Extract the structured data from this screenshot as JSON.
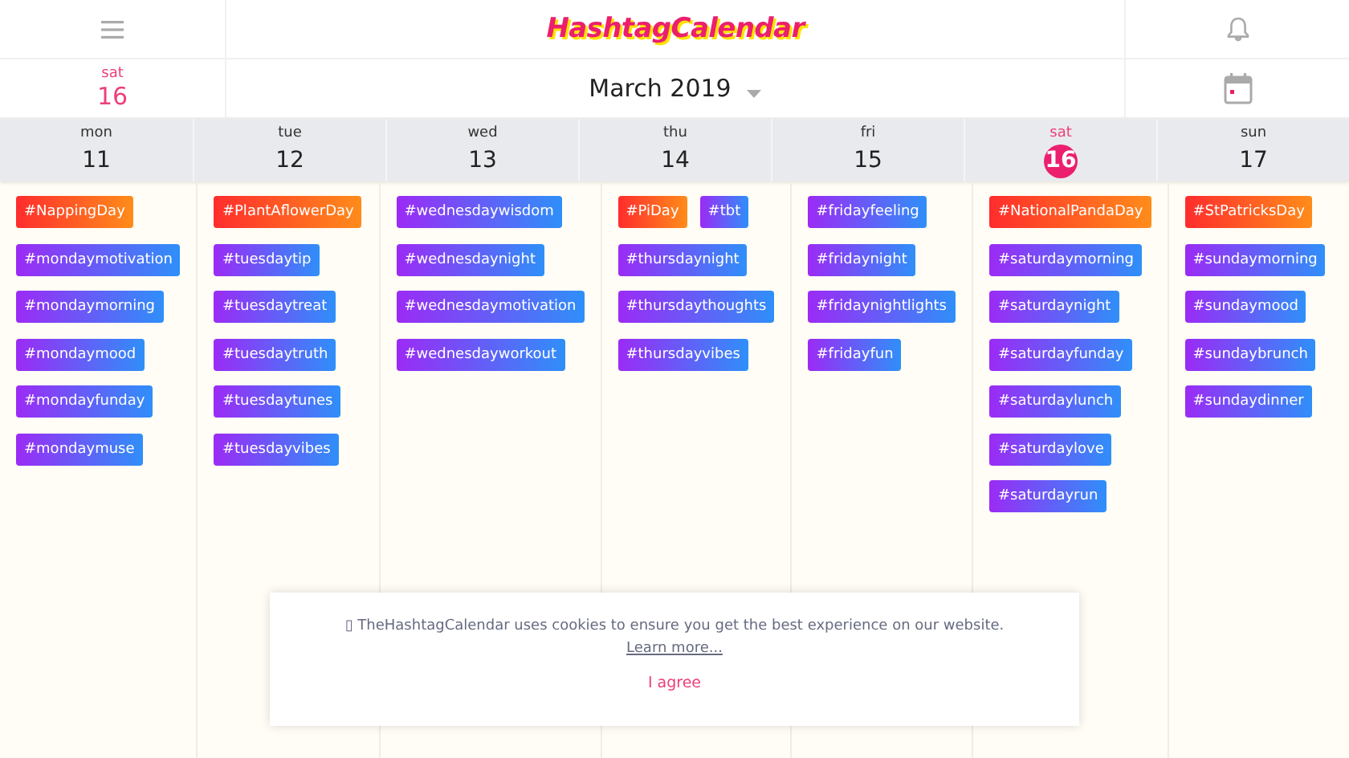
{
  "header": {
    "logo": "HashtagCalendar"
  },
  "today": {
    "weekday": "sat",
    "day": "16"
  },
  "month_picker": {
    "label": "March 2019"
  },
  "days": [
    {
      "weekday": "mon",
      "day": "11",
      "selected": false,
      "tags": [
        {
          "label": "#NappingDay",
          "kind": "holiday"
        },
        {
          "label": "#mondaymotivation",
          "kind": "daily"
        },
        {
          "label": "#mondaymorning",
          "kind": "daily"
        },
        {
          "label": "#mondaymood",
          "kind": "daily"
        },
        {
          "label": "#mondayfunday",
          "kind": "daily"
        },
        {
          "label": "#mondaymuse",
          "kind": "daily"
        }
      ]
    },
    {
      "weekday": "tue",
      "day": "12",
      "selected": false,
      "tags": [
        {
          "label": "#PlantAflowerDay",
          "kind": "holiday"
        },
        {
          "label": "#tuesdaytip",
          "kind": "daily"
        },
        {
          "label": "#tuesdaytreat",
          "kind": "daily"
        },
        {
          "label": "#tuesdaytruth",
          "kind": "daily"
        },
        {
          "label": "#tuesdaytunes",
          "kind": "daily"
        },
        {
          "label": "#tuesdayvibes",
          "kind": "daily"
        }
      ]
    },
    {
      "weekday": "wed",
      "day": "13",
      "selected": false,
      "tags": [
        {
          "label": "#wednesdaywisdom",
          "kind": "daily"
        },
        {
          "label": "#wednesdaynight",
          "kind": "daily"
        },
        {
          "label": "#wednesdaymotivation",
          "kind": "daily"
        },
        {
          "label": "#wednesdayworkout",
          "kind": "daily"
        }
      ]
    },
    {
      "weekday": "thu",
      "day": "14",
      "selected": false,
      "tags": [
        {
          "label": "#PiDay",
          "kind": "holiday"
        },
        {
          "label": "#tbt",
          "kind": "daily"
        },
        {
          "label": "#thursdaynight",
          "kind": "daily"
        },
        {
          "label": "#thursdaythoughts",
          "kind": "daily"
        },
        {
          "label": "#thursdayvibes",
          "kind": "daily"
        }
      ]
    },
    {
      "weekday": "fri",
      "day": "15",
      "selected": false,
      "tags": [
        {
          "label": "#fridayfeeling",
          "kind": "daily"
        },
        {
          "label": "#fridaynight",
          "kind": "daily"
        },
        {
          "label": "#fridaynightlights",
          "kind": "daily"
        },
        {
          "label": "#fridayfun",
          "kind": "daily"
        }
      ]
    },
    {
      "weekday": "sat",
      "day": "16",
      "selected": true,
      "tags": [
        {
          "label": "#NationalPandaDay",
          "kind": "holiday"
        },
        {
          "label": "#saturdaymorning",
          "kind": "daily"
        },
        {
          "label": "#saturdaynight",
          "kind": "daily"
        },
        {
          "label": "#saturdayfunday",
          "kind": "daily"
        },
        {
          "label": "#saturdaylunch",
          "kind": "daily"
        },
        {
          "label": "#saturdaylove",
          "kind": "daily"
        },
        {
          "label": "#saturdayrun",
          "kind": "daily"
        }
      ]
    },
    {
      "weekday": "sun",
      "day": "17",
      "selected": false,
      "tags": [
        {
          "label": "#StPatricksDay",
          "kind": "holiday"
        },
        {
          "label": "#sundaymorning",
          "kind": "daily"
        },
        {
          "label": "#sundaymood",
          "kind": "daily"
        },
        {
          "label": "#sundaybrunch",
          "kind": "daily"
        },
        {
          "label": "#sundaydinner",
          "kind": "daily"
        }
      ]
    }
  ],
  "cookie_banner": {
    "message": "▯ TheHashtagCalendar uses cookies to ensure you get the best experience on our website.",
    "link": "Learn more...",
    "button": "I agree"
  }
}
